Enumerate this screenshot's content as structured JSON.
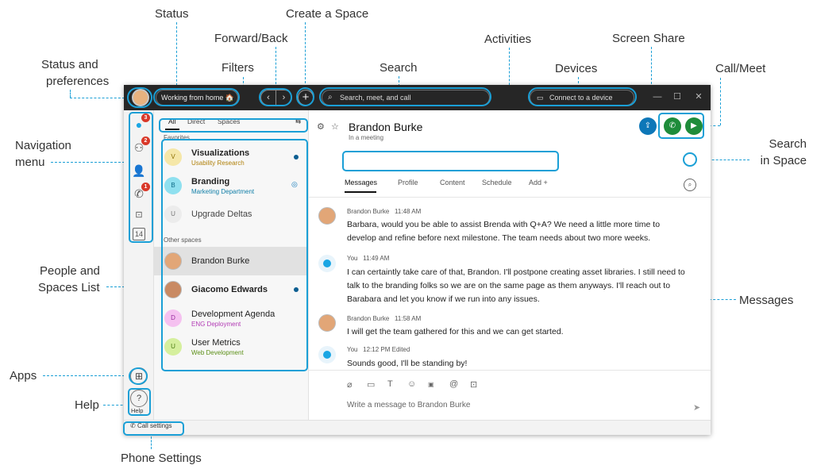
{
  "callouts": {
    "status": "Status",
    "create_space": "Create a Space",
    "forward_back": "Forward/Back",
    "activities": "Activities",
    "screen_share": "Screen Share",
    "status_prefs_line1": "Status and",
    "status_prefs_line2": "preferences",
    "filters": "Filters",
    "search": "Search",
    "devices": "Devices",
    "call_meet": "Call/Meet",
    "navigation_line1": "Navigation",
    "navigation_line2": "menu",
    "search_space_line1": "Search",
    "search_space_line2": "in Space",
    "people_line1": "People and",
    "people_line2": "Spaces List",
    "messages": "Messages",
    "apps": "Apps",
    "help": "Help",
    "phone_settings": "Phone Settings"
  },
  "titlebar": {
    "status_text": "Working from home 🏠",
    "back_icon": "chevron-left-icon",
    "forward_icon": "chevron-right-icon",
    "create_icon": "plus-icon",
    "search_placeholder": "Search, meet, and call",
    "device_text": "Connect to a device"
  },
  "navrail": {
    "items": [
      {
        "icon": "messaging-icon",
        "badge": "3"
      },
      {
        "icon": "teams-icon",
        "badge": "2"
      },
      {
        "icon": "contacts-icon",
        "badge": ""
      },
      {
        "icon": "calling-icon",
        "badge": "1"
      },
      {
        "icon": "voicemail-icon",
        "badge": ""
      },
      {
        "icon": "calendar-icon",
        "label": "14"
      }
    ],
    "help_label": "Help"
  },
  "filters": {
    "tabs": [
      "All",
      "Direct",
      "Spaces"
    ]
  },
  "list": {
    "favorites_label": "Favorites",
    "other_label": "Other spaces",
    "favorites": [
      {
        "initial": "V",
        "title": "Visualizations",
        "subtitle": "Usability Research",
        "sub_color": "#b0800a",
        "bg": "#f5e7a8",
        "bold": true,
        "indicator": "dot"
      },
      {
        "initial": "B",
        "title": "Branding",
        "subtitle": "Marketing Department",
        "sub_color": "#117fa8",
        "bg": "#8fe0ef",
        "bold": true,
        "indicator": "at"
      },
      {
        "initial": "U",
        "title": "Upgrade Deltas",
        "subtitle": "",
        "sub_color": "",
        "bg": "#ececec",
        "bold": false,
        "indicator": ""
      }
    ],
    "others": [
      {
        "initial": "",
        "title": "Brandon Burke",
        "subtitle": "",
        "sub_color": "",
        "bg": "",
        "bold": false,
        "indicator": "",
        "selected": true,
        "face": true
      },
      {
        "initial": "",
        "title": "Giacomo Edwards",
        "subtitle": "",
        "sub_color": "",
        "bg": "",
        "bold": true,
        "indicator": "dot",
        "face": true
      },
      {
        "initial": "D",
        "title": "Development Agenda",
        "subtitle": "ENG Deployment",
        "sub_color": "#b23bb5",
        "bg": "#f5c1f0",
        "bold": false,
        "indicator": ""
      },
      {
        "initial": "U",
        "title": "User Metrics",
        "subtitle": "Web Development",
        "sub_color": "#5b8f16",
        "bg": "#d5ef9d",
        "bold": false,
        "indicator": ""
      }
    ]
  },
  "space": {
    "name": "Brandon Burke",
    "status": "In a meeting",
    "tabs": [
      "Messages",
      "Profile",
      "Content",
      "Schedule",
      "Add +"
    ]
  },
  "messages": [
    {
      "sender": "Brandon Burke",
      "time": "11:48 AM",
      "self": false,
      "text": "Barbara, would you be able to assist Brenda with Q+A? We need a little more time to develop and refine before next milestone. The team needs about two more weeks."
    },
    {
      "sender": "You",
      "time": "11:49 AM",
      "self": true,
      "text": "I can certaintly take care of that, Brandon. I'll postpone creating asset libraries. I still need to talk to the branding folks so we are on the same page as them anyways. I'll reach out to Barabara and let you know if we run into any issues."
    },
    {
      "sender": "Brandon Burke",
      "time": "11:58 AM",
      "self": false,
      "text": "I will get the team gathered for this and we can get started."
    },
    {
      "sender": "You",
      "time": "12:12 PM Edited",
      "self": true,
      "text": "Sounds good, I'll be standing by!"
    }
  ],
  "composer": {
    "placeholder": "Write a message to Brandon Burke",
    "tools": [
      "attach-icon",
      "whiteboard-icon",
      "format-icon",
      "emoji-icon",
      "gif-icon",
      "mention-icon",
      "screen-capture-icon"
    ]
  },
  "bottombar": {
    "call_settings": "Call settings"
  },
  "colors": {
    "accent": "#1a9fd6",
    "call_green": "#1e8c3a",
    "share_blue": "#0d77b8",
    "titlebar": "#262626"
  }
}
